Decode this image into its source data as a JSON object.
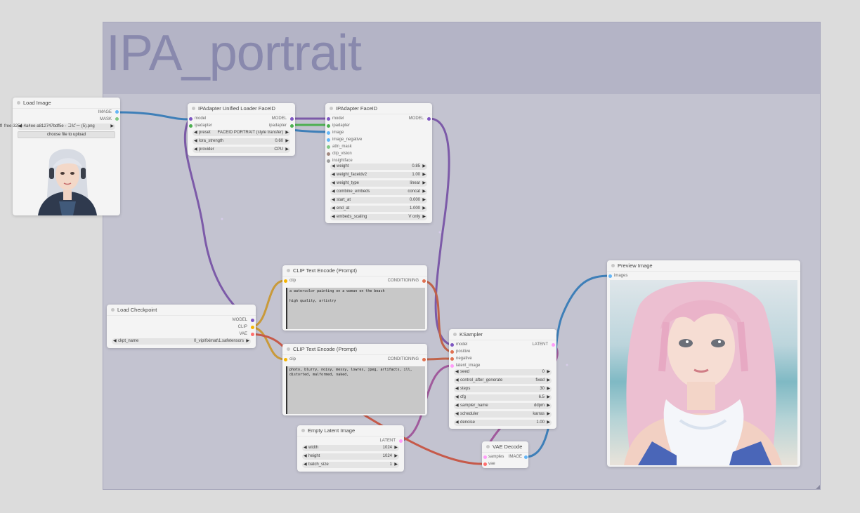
{
  "group": {
    "title": "IPA_portrait"
  },
  "nodes": {
    "load_image": {
      "title": "Load Image",
      "outputs": [
        "IMAGE",
        "MASK"
      ],
      "image_file": "free-3254-4a4ee-a812747bdf5e - コピー (5).png",
      "file_prefix": "fl",
      "upload_label": "choose file to upload",
      "preview_alt": "portrait of a woman with silver hair and headphones"
    },
    "ipa_loader": {
      "title": "IPAdapter Unified Loader FaceID",
      "inputs": [
        "model",
        "ipadapter"
      ],
      "outputs": [
        "MODEL",
        "ipadapter"
      ],
      "widgets": [
        {
          "label": "preset",
          "value": "FACEID PORTRAIT (style transfer)"
        },
        {
          "label": "lora_strength",
          "value": "0.60"
        },
        {
          "label": "provider",
          "value": "CPU"
        }
      ]
    },
    "ipa_faceid": {
      "title": "IPAdapter FaceID",
      "inputs": [
        "model",
        "ipadapter",
        "image",
        "image_negative",
        "attn_mask",
        "clip_vision",
        "insightface"
      ],
      "outputs": [
        "MODEL"
      ],
      "widgets": [
        {
          "label": "weight",
          "value": "0.85"
        },
        {
          "label": "weight_faceidv2",
          "value": "1.00"
        },
        {
          "label": "weight_type",
          "value": "linear"
        },
        {
          "label": "combine_embeds",
          "value": "concat"
        },
        {
          "label": "start_at",
          "value": "0.000"
        },
        {
          "label": "end_at",
          "value": "1.000"
        },
        {
          "label": "embeds_scaling",
          "value": "V only"
        }
      ]
    },
    "clip_pos": {
      "title": "CLIP Text Encode (Prompt)",
      "input": "clip",
      "output": "CONDITIONING",
      "text": "a watercolor painting on a woman on the beach\n\nhigh quality, artistry"
    },
    "clip_neg": {
      "title": "CLIP Text Encode (Prompt)",
      "input": "clip",
      "output": "CONDITIONING",
      "text": "photo, blurry, noisy, messy, lowres, jpeg, artifacts, ill, distorted, malformed, naked,"
    },
    "checkpoint": {
      "title": "Load Checkpoint",
      "outputs": [
        "MODEL",
        "CLIP",
        "VAE"
      ],
      "widgets": [
        {
          "label": "ckpt_name",
          "value": "0_vip\\fiximat\\1.safetensors"
        }
      ]
    },
    "empty_latent": {
      "title": "Empty Latent Image",
      "output": "LATENT",
      "widgets": [
        {
          "label": "width",
          "value": "1024"
        },
        {
          "label": "height",
          "value": "1024"
        },
        {
          "label": "batch_size",
          "value": "1"
        }
      ]
    },
    "ksampler": {
      "title": "KSampler",
      "inputs": [
        "model",
        "positive",
        "negative",
        "latent_image"
      ],
      "output": "LATENT",
      "widgets": [
        {
          "label": "seed",
          "value": "0"
        },
        {
          "label": "control_after_generate",
          "value": "fixed"
        },
        {
          "label": "steps",
          "value": "30"
        },
        {
          "label": "cfg",
          "value": "6.5"
        },
        {
          "label": "sampler_name",
          "value": "ddpm"
        },
        {
          "label": "scheduler",
          "value": "karras"
        },
        {
          "label": "denoise",
          "value": "1.00"
        }
      ]
    },
    "vae_decode": {
      "title": "VAE Decode",
      "inputs": [
        "samples",
        "vae"
      ],
      "output": "IMAGE"
    },
    "preview": {
      "title": "Preview Image",
      "input": "images",
      "preview_alt": "watercolor portrait of a woman with pink hair on a beach"
    }
  },
  "colors": {
    "model": "#7e57c2",
    "clip": "#f5b400",
    "vae": "#ff6e6e",
    "conditioning": "#e07050",
    "latent": "#ff9cf9",
    "image": "#64b5f6",
    "ipadapter": "#4caf50",
    "link_model": "#7c5aa8",
    "link_image": "#3e7fb8",
    "link_clip": "#c99a3a",
    "link_cond": "#c0634a",
    "link_latent": "#a05a9c",
    "link_vae": "#c65a4a"
  }
}
